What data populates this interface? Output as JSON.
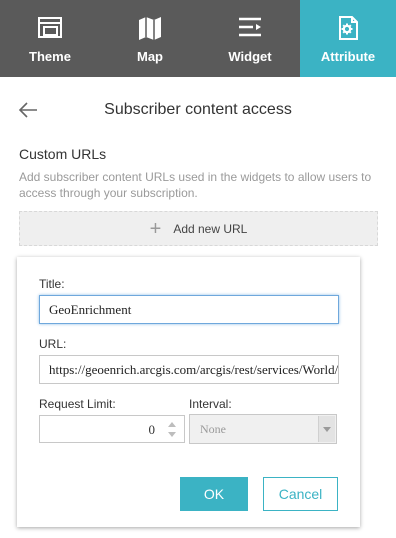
{
  "tabs": [
    {
      "label": "Theme",
      "icon": "theme-icon",
      "active": false
    },
    {
      "label": "Map",
      "icon": "map-icon",
      "active": false
    },
    {
      "label": "Widget",
      "icon": "widget-icon",
      "active": false
    },
    {
      "label": "Attribute",
      "icon": "attribute-icon",
      "active": true
    }
  ],
  "header": {
    "title": "Subscriber content access",
    "back_icon": "back-arrow-icon"
  },
  "custom_urls": {
    "title": "Custom URLs",
    "description": "Add subscriber content URLs used in the widgets to allow users to access through your subscription.",
    "add_button_label": "Add new URL"
  },
  "form": {
    "title_label": "Title:",
    "title_value": "GeoEnrichment",
    "url_label": "URL:",
    "url_value": "https://geoenrich.arcgis.com/arcgis/rest/services/World/GeoEnrichmentServer",
    "request_limit_label": "Request Limit:",
    "request_limit_value": "0",
    "interval_label": "Interval:",
    "interval_value": "None",
    "ok_label": "OK",
    "cancel_label": "Cancel"
  },
  "colors": {
    "accent": "#3bb3c4",
    "tabbar_bg": "#5a5a5a"
  }
}
